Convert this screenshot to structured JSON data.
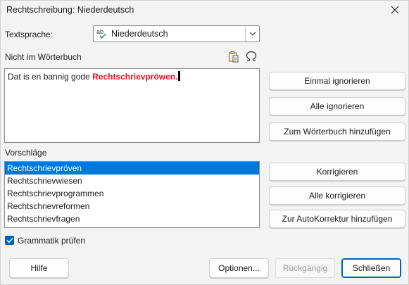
{
  "window": {
    "title": "Rechtschreibung: Niederdeutsch",
    "close_icon": "close-icon"
  },
  "language": {
    "label": "Textsprache:",
    "value": "Niederdeutsch",
    "icon": "spellcheck-abc-icon"
  },
  "not_in_dictionary": {
    "label": "Nicht im Wörterbuch",
    "text_before": "Dat is en bannig gode ",
    "text_error": "Rechtschrievpröwen.",
    "paste_icon": "paste-icon",
    "special_char_icon": "omega-special-character-icon"
  },
  "buttons_right_top": {
    "ignore_once": "Einmal ignorieren",
    "ignore_all": "Alle ignorieren",
    "add_dictionary": "Zum Wörterbuch hinzufügen"
  },
  "suggestions": {
    "label": "Vorschläge",
    "items": [
      "Rechtschrievpröven",
      "Rechtschrievwiesen",
      "Rechtschrievprogrammen",
      "Rechtschrievreformen",
      "Rechtschrievfragen"
    ],
    "selected_index": 0
  },
  "buttons_right_bottom": {
    "correct": "Korrigieren",
    "correct_all": "Alle korrigieren",
    "add_autocorrect": "Zur AutoKorrektur hinzufügen"
  },
  "grammar": {
    "label": "Grammatik prüfen",
    "checked": true
  },
  "footer": {
    "help": "Hilfe",
    "options": "Optionen...",
    "undo": "Rückgängig",
    "close": "Schließen"
  },
  "colors": {
    "accent": "#0078d7",
    "error": "#e81123",
    "checkbox": "#005fb8"
  }
}
